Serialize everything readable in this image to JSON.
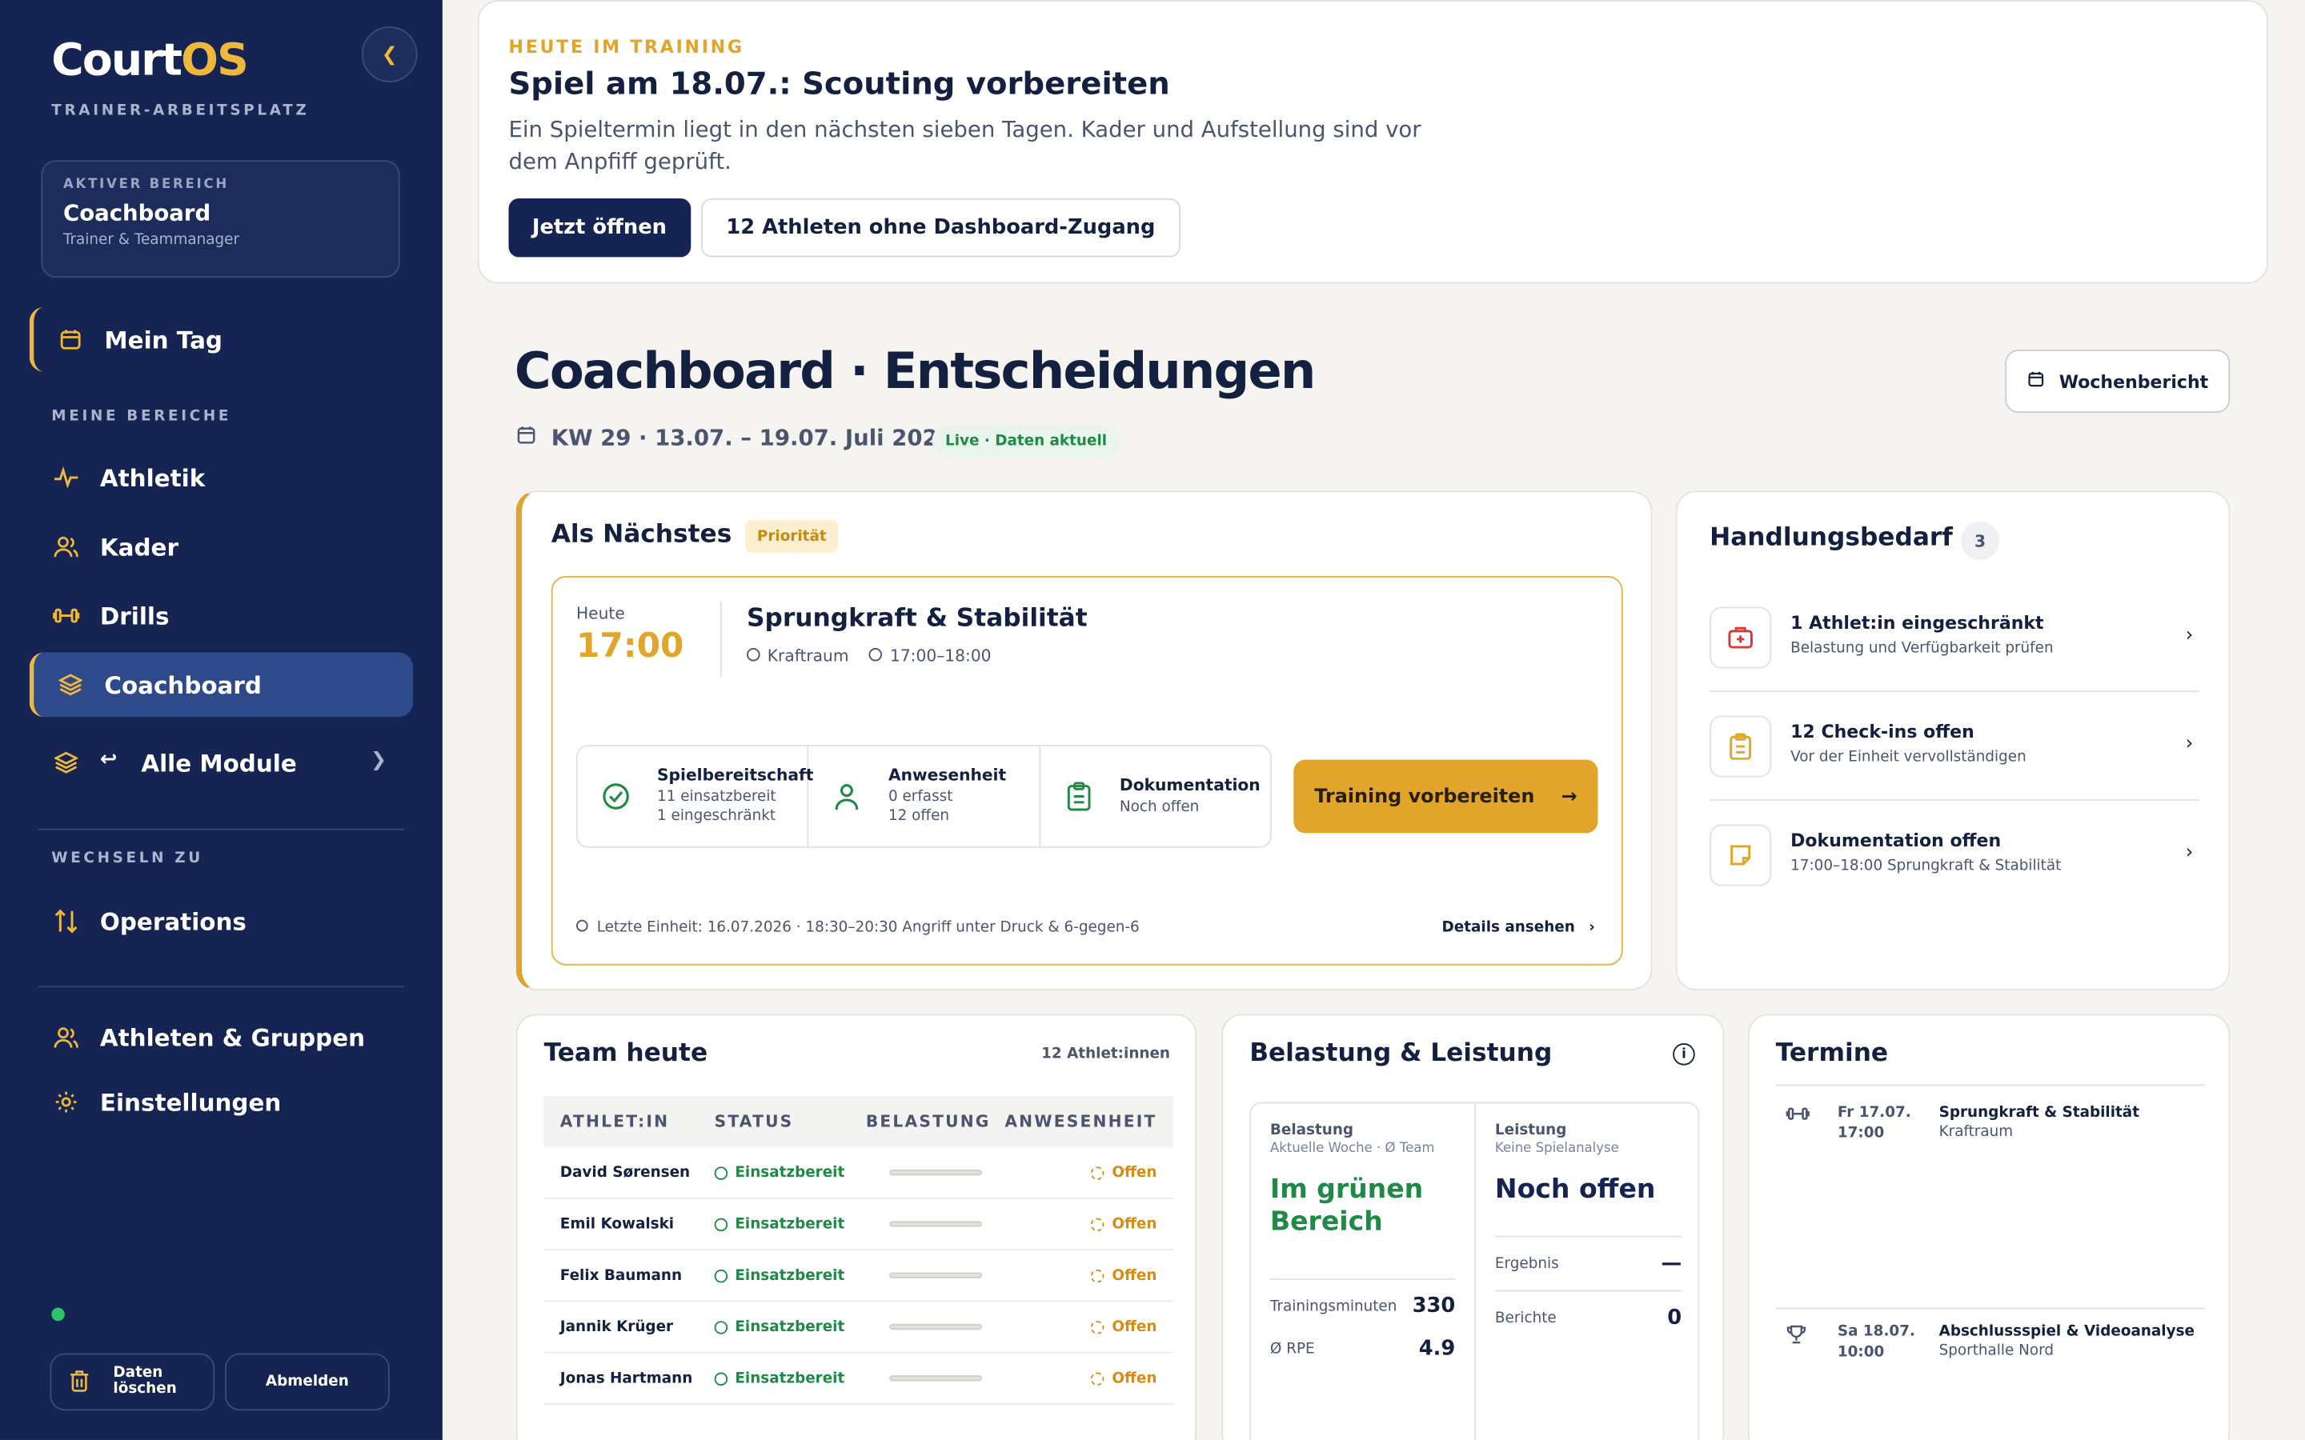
{
  "app": {
    "logo_main": "Court",
    "logo_accent": "OS",
    "subtitle": "TRAINER-ARBEITSPLATZ"
  },
  "sidebar": {
    "active_area": {
      "label": "AKTIVER BEREICH",
      "title": "Coachboard",
      "subtitle": "Trainer & Teammanager"
    },
    "meintag": "Mein Tag",
    "section_mine": "MEINE BEREICHE",
    "items": [
      {
        "label": "Athletik"
      },
      {
        "label": "Kader"
      },
      {
        "label": "Drills"
      },
      {
        "label": "Coachboard"
      },
      {
        "label": "Alle Module"
      }
    ],
    "section_switch": "WECHSELN ZU",
    "operations": "Operations",
    "athleten_gruppen": "Athleten & Gruppen",
    "einstellungen": "Einstellungen",
    "daten_loeschen_1": "Daten",
    "daten_loeschen_2": "löschen",
    "abmelden": "Abmelden"
  },
  "banner": {
    "kicker": "HEUTE IM TRAINING",
    "title": "Spiel am 18.07.: Scouting vorbereiten",
    "text": "Ein Spieltermin liegt in den nächsten sieben Tagen. Kader und Aufstellung sind vor dem Anpfiff geprüft.",
    "btn_primary": "Jetzt öffnen",
    "btn_secondary": "12 Athleten ohne Dashboard-Zugang"
  },
  "header": {
    "title": "Coachboard · Entscheidungen",
    "week": "KW 29 · 13.07. – 19.07. Juli 2026",
    "live": "Live · Daten aktuell",
    "report_btn": "Wochenbericht"
  },
  "next": {
    "title": "Als Nächstes",
    "badge": "Priorität",
    "day": "Heute",
    "time": "17:00",
    "session": "Sprungkraft & Stabilität",
    "room": "Kraftraum",
    "timerange": "17:00–18:00",
    "stats": [
      {
        "title": "Spielbereitschaft",
        "l1": "11 einsatzbereit",
        "l2": "1 eingeschränkt"
      },
      {
        "title": "Anwesenheit",
        "l1": "0 erfasst",
        "l2": "12 offen"
      },
      {
        "title": "Dokumentation",
        "l1": "Noch offen",
        "l2": ""
      }
    ],
    "cta": "Training vorbereiten",
    "last_unit": "Letzte Einheit: 16.07.2026 · 18:30–20:30 Angriff unter Druck & 6-gegen-6",
    "details": "Details ansehen"
  },
  "action": {
    "title": "Handlungsbedarf",
    "count": "3",
    "items": [
      {
        "title": "1 Athlet:in eingeschränkt",
        "sub": "Belastung und Verfügbarkeit prüfen"
      },
      {
        "title": "12 Check-ins offen",
        "sub": "Vor der Einheit vervollständigen"
      },
      {
        "title": "Dokumentation offen",
        "sub": "17:00–18:00 Sprungkraft & Stabilität"
      }
    ]
  },
  "team": {
    "title": "Team heute",
    "count": "12 Athlet:innen",
    "columns": [
      "ATHLET:IN",
      "STATUS",
      "BELASTUNG",
      "ANWESENHEIT"
    ],
    "rows": [
      {
        "name": "David Sørensen",
        "status": "Einsatzbereit",
        "attendance": "Offen"
      },
      {
        "name": "Emil Kowalski",
        "status": "Einsatzbereit",
        "attendance": "Offen"
      },
      {
        "name": "Felix Baumann",
        "status": "Einsatzbereit",
        "attendance": "Offen"
      },
      {
        "name": "Jannik Krüger",
        "status": "Einsatzbereit",
        "attendance": "Offen"
      },
      {
        "name": "Jonas Hartmann",
        "status": "Einsatzbereit",
        "attendance": "Offen"
      }
    ]
  },
  "load": {
    "title": "Belastung & Leistung",
    "left": {
      "k": "Belastung",
      "sub": "Aktuelle Woche · Ø Team",
      "big": "Im grünen Bereich",
      "kv1_k": "Trainingsminuten",
      "kv1_v": "330",
      "kv2_k": "Ø RPE",
      "kv2_v": "4.9"
    },
    "right": {
      "k": "Leistung",
      "sub": "Keine Spielanalyse",
      "big": "Noch offen",
      "kv1_k": "Ergebnis",
      "kv1_v": "—",
      "kv2_k": "Berichte",
      "kv2_v": "0"
    }
  },
  "events": {
    "title": "Termine",
    "items": [
      {
        "day": "Fr 17.07.",
        "time": "17:00",
        "title": "Sprungkraft & Stabilität",
        "loc": "Kraftraum"
      },
      {
        "day": "Sa 18.07.",
        "time": "10:00",
        "title": "Abschlussspiel & Videoanalyse",
        "loc": "Sporthalle Nord"
      }
    ]
  },
  "colors": {
    "sidebar": "#152452",
    "accent": "#e0a52a",
    "success": "#1e8a45",
    "warning": "#d98c12"
  }
}
